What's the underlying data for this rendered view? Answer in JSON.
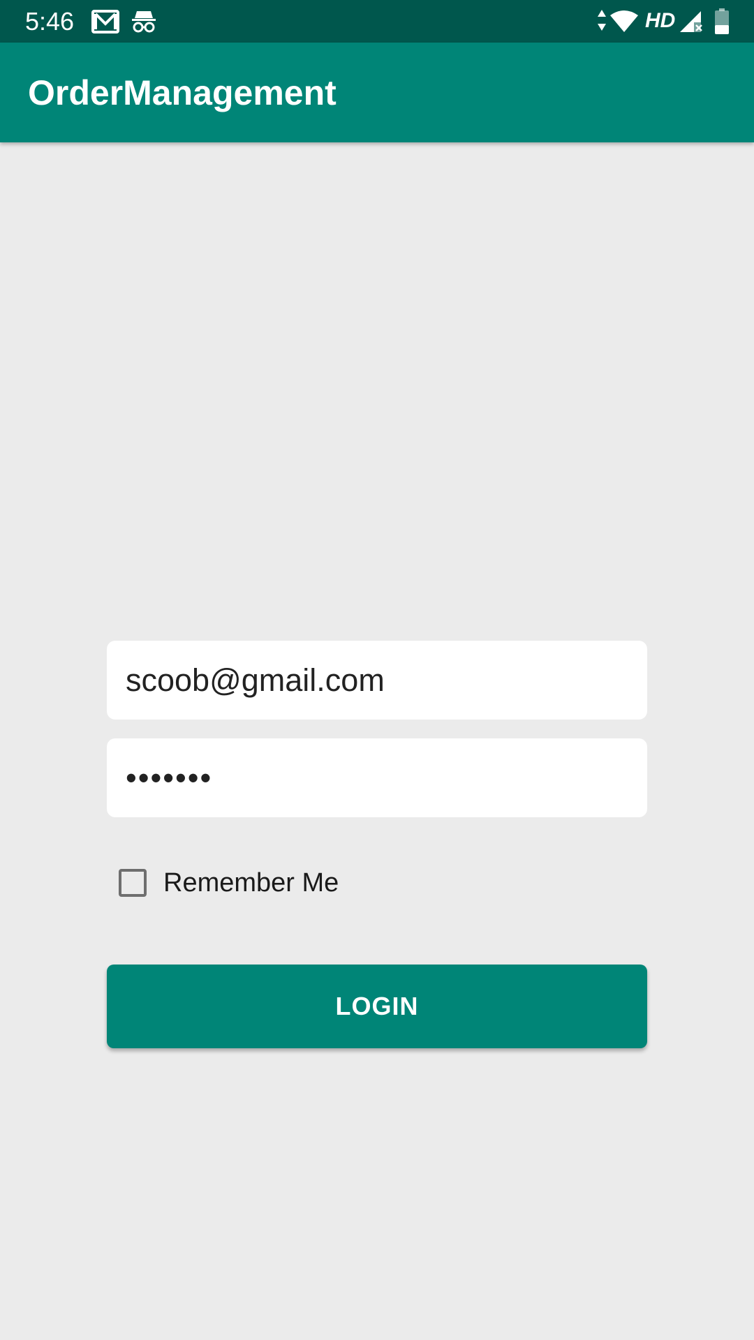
{
  "status_bar": {
    "time": "5:46",
    "network_label": "HD",
    "icons": [
      "gmail-icon",
      "incognito-icon",
      "data-arrows-icon",
      "wifi-icon",
      "signal-icon",
      "battery-icon"
    ]
  },
  "app_bar": {
    "title": "OrderManagement"
  },
  "login_form": {
    "email_value": "scoob@gmail.com",
    "password_mask": "•••••••",
    "remember_me_label": "Remember Me",
    "remember_me_checked": false,
    "login_button_label": "LOGIN"
  },
  "colors": {
    "status_bar": "#00574d",
    "primary": "#008577",
    "background": "#ebebeb",
    "field_background": "#ffffff"
  }
}
